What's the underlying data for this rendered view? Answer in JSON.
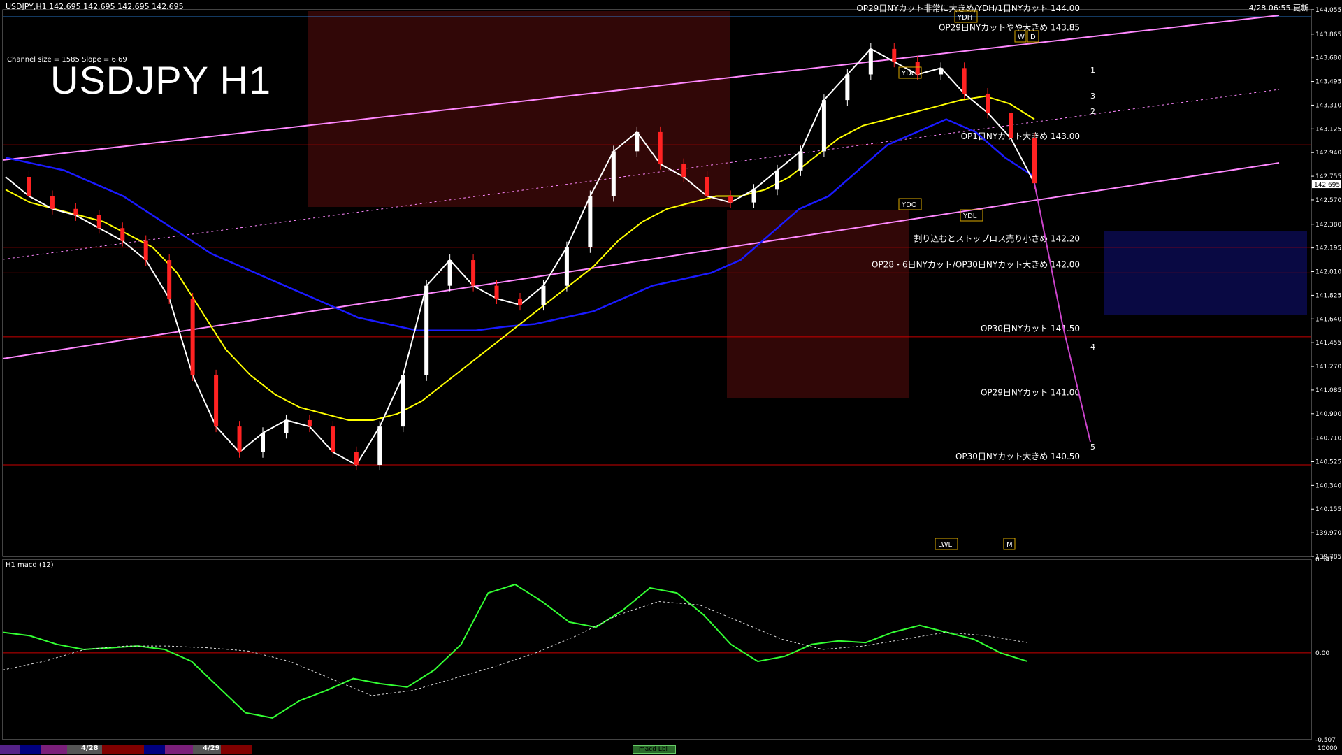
{
  "header": {
    "symbol_info": "USDJPY,H1  142.695 142.695 142.695 142.695",
    "timestamp": "4/28 06:55 更新"
  },
  "chart_title": "USDJPY H1",
  "channel_info": "Channel size = 1585 Slope = 6.69",
  "colors": {
    "background": "#000000",
    "level_line": "#cc0000",
    "ma_white": "#ffffff",
    "ma_yellow": "#ffff00",
    "ma_blue": "#1a1aff",
    "channel": "#ff88ff",
    "bollinger_red": "#cc0000",
    "chikou_green": "#00cc00",
    "macd_green": "#33ff33",
    "macd_pink": "#ff88aa",
    "signal_dashed": "#dddddd"
  },
  "chart_data": {
    "type": "line",
    "price_scale": {
      "ylim": [
        139.785,
        144.055
      ],
      "ticks": [
        "144.055",
        "143.865",
        "143.680",
        "143.495",
        "143.310",
        "143.125",
        "142.940",
        "142.755",
        "142.570",
        "142.380",
        "142.195",
        "142.010",
        "141.825",
        "141.640",
        "141.455",
        "141.270",
        "141.085",
        "140.900",
        "140.710",
        "140.525",
        "140.340",
        "140.155",
        "139.970",
        "139.785"
      ],
      "current_price": "142.695"
    },
    "levels": [
      {
        "price": 144.0,
        "label": "OP29日NYカット非常に大きめ/YDH/1日NYカット 144.00",
        "color": "#3399ff"
      },
      {
        "price": 143.85,
        "label": "OP29日NYカットやや大きめ 143.85",
        "color": "#3399ff"
      },
      {
        "price": 143.0,
        "label": "OP1日NYカット大きめ 143.00",
        "color": "#cc0000"
      },
      {
        "price": 142.2,
        "label": "割り込むとストップロス売り小さめ 142.20",
        "color": "#cc0000"
      },
      {
        "price": 142.0,
        "label": "OP28・6日NYカット/OP30日NYカット大きめ 142.00",
        "color": "#cc0000"
      },
      {
        "price": 141.5,
        "label": "OP30日NYカット 141.50",
        "color": "#cc0000"
      },
      {
        "price": 141.0,
        "label": "OP29日NYカット 141.00",
        "color": "#cc0000"
      },
      {
        "price": 140.5,
        "label": "OP30日NYカット大きめ 140.50",
        "color": "#cc0000"
      }
    ],
    "box_labels": [
      "YDC",
      "YDO",
      "YDL",
      "YDH",
      "W",
      "D",
      "LWL",
      "M"
    ],
    "wave_labels": [
      "1",
      "2",
      "3",
      "4",
      "5"
    ],
    "series": [
      {
        "values": [
          142.75,
          142.6,
          142.5,
          142.45,
          142.35,
          142.25,
          142.1,
          141.8,
          141.2,
          140.8,
          140.6,
          140.75,
          140.85,
          140.8,
          140.6,
          140.5,
          140.8,
          141.2,
          141.9,
          142.1,
          141.9,
          141.8,
          141.75,
          141.9,
          142.2,
          142.6,
          142.95,
          143.1,
          142.85,
          142.75,
          142.6,
          142.55,
          142.65,
          142.8,
          142.95,
          143.35,
          143.55,
          143.75,
          143.65,
          143.55,
          143.6,
          143.4,
          143.25,
          143.05,
          142.7
        ]
      },
      {
        "values": [
          142.65,
          142.55,
          142.5,
          142.45,
          142.4,
          142.3,
          142.2,
          142.0,
          141.7,
          141.4,
          141.2,
          141.05,
          140.95,
          140.9,
          140.85,
          140.85,
          140.9,
          141.0,
          141.15,
          141.3,
          141.45,
          141.6,
          141.75,
          141.9,
          142.05,
          142.25,
          142.4,
          142.5,
          142.55,
          142.6,
          142.6,
          142.65,
          142.75,
          142.9,
          143.05,
          143.15,
          143.2,
          143.25,
          143.3,
          143.35,
          143.38,
          143.32,
          143.2
        ]
      },
      {
        "values": [
          142.9,
          142.85,
          142.8,
          142.7,
          142.6,
          142.45,
          142.3,
          142.15,
          142.05,
          141.95,
          141.85,
          141.75,
          141.65,
          141.6,
          141.55,
          141.55,
          141.55,
          141.58,
          141.6,
          141.65,
          141.7,
          141.8,
          141.9,
          141.95,
          142.0,
          142.1,
          142.3,
          142.5,
          142.6,
          142.8,
          143.0,
          143.1,
          143.2,
          143.1,
          142.9,
          142.75
        ]
      },
      {
        "values": [
          0.12,
          0.1,
          0.05,
          0.02,
          0.03,
          0.04,
          0.02,
          -0.05,
          -0.2,
          -0.35,
          -0.38,
          -0.28,
          -0.22,
          -0.15,
          -0.18,
          -0.2,
          -0.1,
          0.05,
          0.35,
          0.4,
          0.3,
          0.18,
          0.15,
          0.25,
          0.38,
          0.35,
          0.22,
          0.05,
          -0.05,
          -0.02,
          0.05,
          0.07,
          0.06,
          0.12,
          0.16,
          0.12,
          0.08,
          0.0,
          -0.05
        ]
      },
      {
        "values": [
          -0.1,
          -0.05,
          0.02,
          0.04,
          0.04,
          0.03,
          0.01,
          -0.05,
          -0.15,
          -0.25,
          -0.22,
          -0.15,
          -0.08,
          0.0,
          0.1,
          0.22,
          0.3,
          0.28,
          0.18,
          0.08,
          0.02,
          0.04,
          0.08,
          0.12,
          0.1,
          0.06
        ]
      }
    ],
    "macd": {
      "title": "H1 macd (12)",
      "ylim": [
        -0.507,
        0.547
      ],
      "ticks": [
        "0.547",
        "0.00",
        "-0.507"
      ],
      "zero_line": 0
    }
  },
  "bottom_bar": {
    "date_a": "4/28",
    "date_b": "4/29",
    "macd_button": "macd Lbl",
    "right_value": "10000"
  }
}
